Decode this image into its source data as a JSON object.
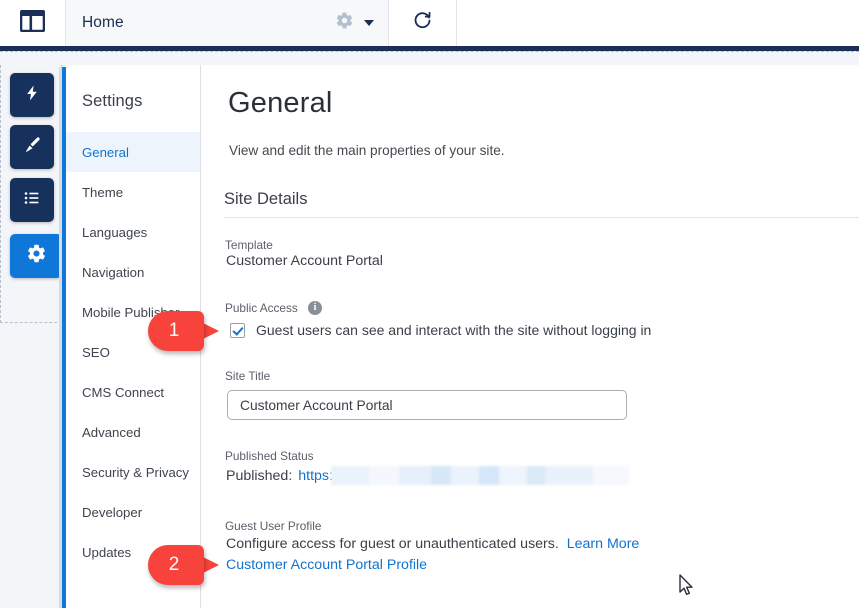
{
  "topbar": {
    "app_icon": "builder-layout-icon",
    "page_tab": "Home",
    "gear_icon": "gear-icon",
    "caret_icon": "chevron-down-icon",
    "refresh_icon": "refresh-icon"
  },
  "rail": {
    "items": [
      {
        "icon": "lightning-bolt-icon",
        "active": false
      },
      {
        "icon": "paintbrush-icon",
        "active": false
      },
      {
        "icon": "list-icon",
        "active": false
      },
      {
        "icon": "gear-icon",
        "active": true
      }
    ]
  },
  "settings": {
    "title": "Settings",
    "items": [
      {
        "label": "General",
        "selected": true
      },
      {
        "label": "Theme",
        "selected": false
      },
      {
        "label": "Languages",
        "selected": false
      },
      {
        "label": "Navigation",
        "selected": false
      },
      {
        "label": "Mobile Publisher",
        "selected": false
      },
      {
        "label": "SEO",
        "selected": false
      },
      {
        "label": "CMS Connect",
        "selected": false
      },
      {
        "label": "Advanced",
        "selected": false
      },
      {
        "label": "Security & Privacy",
        "selected": false
      },
      {
        "label": "Developer",
        "selected": false
      },
      {
        "label": "Updates",
        "selected": false
      }
    ]
  },
  "main": {
    "title": "General",
    "description": "View and edit the main properties of your site.",
    "section_heading": "Site Details",
    "template": {
      "label": "Template",
      "value": "Customer Account Portal"
    },
    "public_access": {
      "label": "Public Access",
      "info_icon": "info-icon",
      "info_glyph": "i",
      "checkbox_checked": true,
      "checkbox_label": "Guest users can see and interact with the site without logging in"
    },
    "site_title": {
      "label": "Site Title",
      "value": "Customer Account Portal",
      "placeholder": "Site Title"
    },
    "published_status": {
      "label": "Published Status",
      "prefix": "Published:",
      "url_visible": "https:",
      "url_redacted": true
    },
    "guest_user_profile": {
      "label": "Guest User Profile",
      "description": "Configure access for guest or unauthenticated users.",
      "learn_more": "Learn More",
      "profile_link": "Customer Account Portal Profile"
    }
  },
  "callouts": [
    {
      "number": "1"
    },
    {
      "number": "2"
    }
  ],
  "colors": {
    "accent_blue": "#0f77d8",
    "link_blue": "#1273cd",
    "navy": "#16325c",
    "callout_red": "#f8433c"
  }
}
